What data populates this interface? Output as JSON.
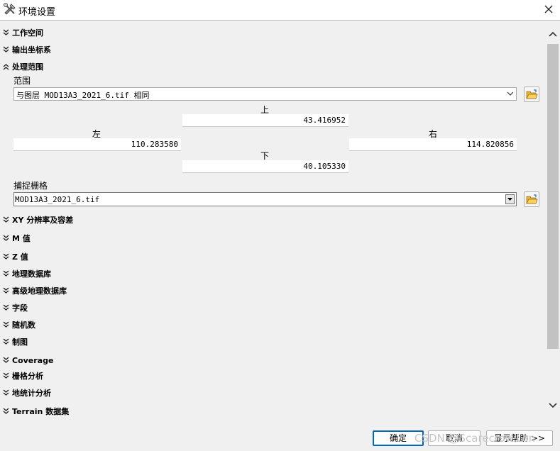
{
  "window": {
    "title": "环境设置"
  },
  "sections": {
    "workspace": "工作空间",
    "output_coords": "输出坐标系",
    "processing_extent": "处理范围",
    "xy_resolution": "XY 分辨率及容差",
    "m_values": "M 值",
    "z_values": "Z 值",
    "geodatabase": "地理数据库",
    "advanced_geodatabase": "高级地理数据库",
    "fields": "字段",
    "random_numbers": "随机数",
    "cartography": "制图",
    "coverage": "Coverage",
    "raster_analysis": "栅格分析",
    "geostatistical": "地统计分析",
    "terrain_dataset": "Terrain 数据集"
  },
  "extent": {
    "label": "范围",
    "value": "与图层 MOD13A3_2021_6.tif 相同",
    "top_label": "上",
    "top": "43.416952",
    "left_label": "左",
    "left": "110.283580",
    "right_label": "右",
    "right": "114.820856",
    "bottom_label": "下",
    "bottom": "40.105330"
  },
  "snap_raster": {
    "label": "捕捉栅格",
    "value": "MOD13A3_2021_6.tif"
  },
  "footer": {
    "ok": "确定",
    "cancel": "取消",
    "show_help": "显示帮助 >>"
  },
  "watermark": "CSDN @Scarecrow.Lon"
}
